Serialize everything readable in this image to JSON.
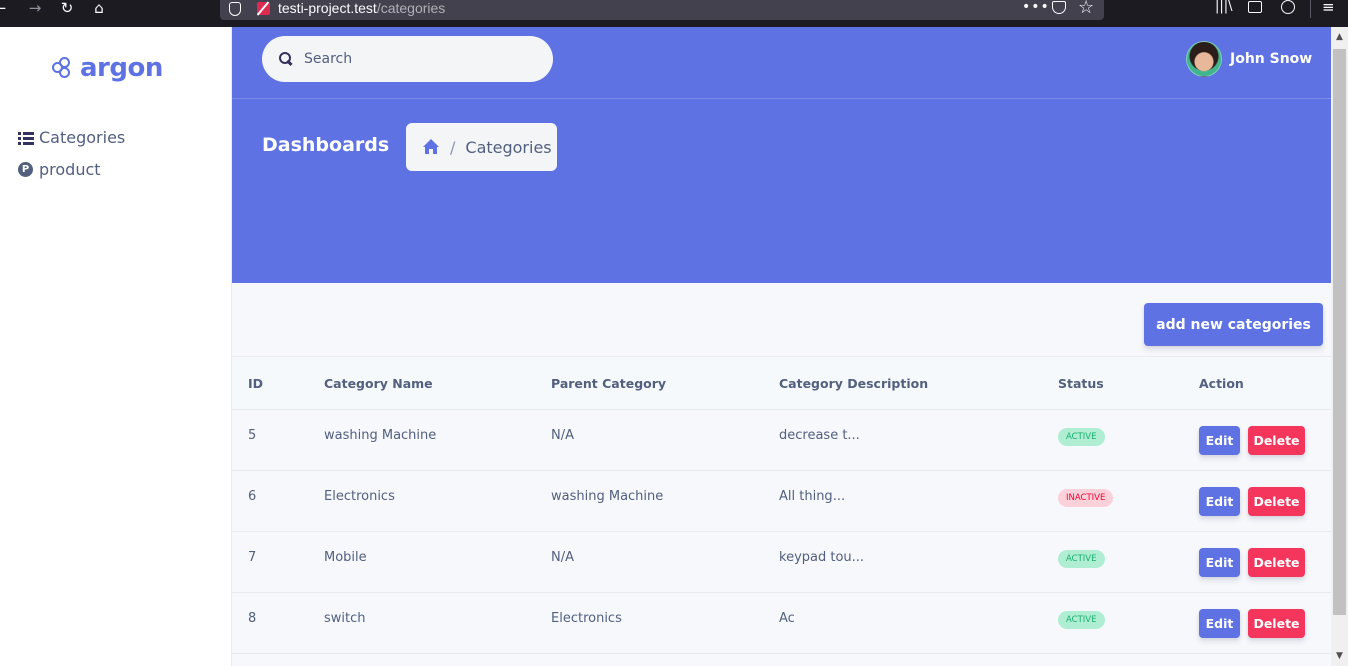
{
  "browser": {
    "url_host": "testi-project.test",
    "url_path": "/categories"
  },
  "brand": {
    "name": "argon"
  },
  "sidebar": {
    "items": [
      {
        "label": "Categories",
        "icon": "list-icon"
      },
      {
        "label": "product",
        "icon": "product-p-icon"
      }
    ]
  },
  "header": {
    "search_placeholder": "Search",
    "user_name": "John Snow",
    "page_title": "Dashboards",
    "breadcrumb": {
      "current": "Categories",
      "separator": "/"
    }
  },
  "main": {
    "add_button_label": "add new categories",
    "table": {
      "columns": [
        "ID",
        "Category Name",
        "Parent Category",
        "Category Description",
        "Status",
        "Action"
      ],
      "rows": [
        {
          "id": "5",
          "name": "washing Machine",
          "parent": "N/A",
          "description": "decrease t...",
          "status": "ACTIVE",
          "edit": "Edit",
          "delete": "Delete"
        },
        {
          "id": "6",
          "name": "Electronics",
          "parent": "washing Machine",
          "description": "All thing...",
          "status": "INACTIVE",
          "edit": "Edit",
          "delete": "Delete"
        },
        {
          "id": "7",
          "name": "Mobile",
          "parent": "N/A",
          "description": "keypad tou...",
          "status": "ACTIVE",
          "edit": "Edit",
          "delete": "Delete"
        },
        {
          "id": "8",
          "name": "switch",
          "parent": "Electronics",
          "description": "Ac",
          "status": "ACTIVE",
          "edit": "Edit",
          "delete": "Delete"
        }
      ]
    }
  },
  "colors": {
    "primary": "#5e72e4",
    "danger": "#f5365c",
    "success": "#2dce89"
  }
}
